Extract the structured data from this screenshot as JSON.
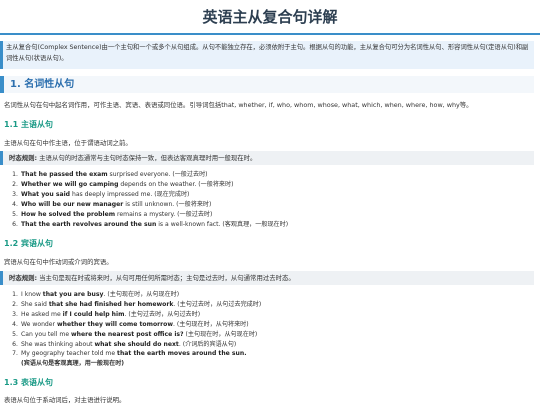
{
  "title": "英语主从复合句详解",
  "intro": "主从复合句(Complex Sentence)由一个主句和一个或多个从句组成。从句不能独立存在，必须依附于主句。根据从句的功能，主从复合句可分为名词性从句、形容词性从句(定语从句)和副词性从句(状语从句)。",
  "section1": {
    "heading": "1. 名词性从句",
    "desc": "名词性从句在句中起名词作用，可作主语、宾语、表语或同位语。引导词包括that, whether, if, who, whom, whose, what, which, when, where, how, why等。"
  },
  "subject_clause": {
    "heading": "1.1 主语从句",
    "desc": "主语从句在句中作主语，位于谓语动词之前。",
    "rule_label": "时态规则:",
    "rule_text": "主语从句的时态通常与主句时态保持一致，但表达客观真理时用一般现在时。",
    "items": [
      {
        "num": "1.",
        "bold": "That he passed the exam",
        "rest": " surprised everyone. (一般过去时)"
      },
      {
        "num": "2.",
        "bold": "Whether we will go camping",
        "rest": " depends on the weather. (一般将来时)"
      },
      {
        "num": "3.",
        "bold": "What you said",
        "rest": " has deeply impressed me. (现在完成时)"
      },
      {
        "num": "4.",
        "bold": "Who will be our new manager",
        "rest": " is still unknown. (一般将来时)"
      },
      {
        "num": "5.",
        "bold": "How he solved the problem",
        "rest": " remains a mystery. (一般过去时)"
      },
      {
        "num": "6.",
        "bold": "That the earth revolves around the sun",
        "rest": " is a well-known fact. (客观真理，一般现在时)"
      }
    ]
  },
  "object_clause": {
    "heading": "1.2 宾语从句",
    "desc": "宾语从句在句中作动词或介词的宾语。",
    "rule_label": "时态规则:",
    "rule_text": "当主句是现在时或将来时，从句可用任何所需时态；主句是过去时，从句通常用过去时态。",
    "items": [
      {
        "num": "1.",
        "pre": "I know ",
        "bold": "that you are busy",
        "rest": ". (主句现在时，从句现在时)"
      },
      {
        "num": "2.",
        "pre": "She said ",
        "bold": "that she had finished her homework",
        "rest": ". (主句过去时，从句过去完成时)"
      },
      {
        "num": "3.",
        "pre": "He asked me ",
        "bold": "if I could help him",
        "rest": ". (主句过去时，从句过去时)"
      },
      {
        "num": "4.",
        "pre": "We wonder ",
        "bold": "whether they will come tomorrow",
        "rest": ". (主句现在时，从句将来时)"
      },
      {
        "num": "5.",
        "pre": "Can you tell me ",
        "bold": "where the nearest post office is?",
        "rest": " (主句现在时，从句现在时)"
      },
      {
        "num": "6.",
        "pre": "She was thinking about ",
        "bold": "what she should do next",
        "rest": ". (介词后的宾语从句)"
      },
      {
        "num": "7.",
        "pre": "My geography teacher told me ",
        "bold": "that the earth moves around the sun.",
        "rest": "",
        "sub": "(宾语从句是客观真理，用一般现在时)"
      }
    ]
  },
  "predicative_clause": {
    "heading": "1.3 表语从句",
    "desc": "表语从句位于系动词后，对主语进行说明。"
  }
}
